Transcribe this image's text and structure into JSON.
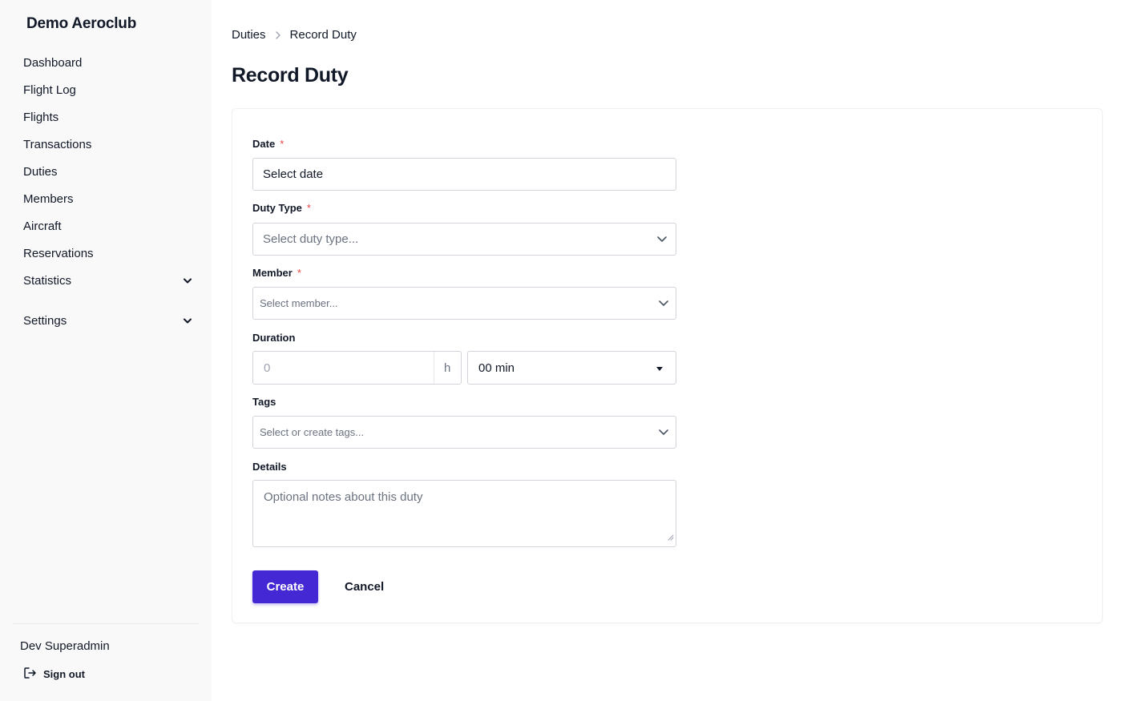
{
  "app": {
    "brand": "Demo Aeroclub"
  },
  "sidebar": {
    "items": [
      {
        "label": "Dashboard"
      },
      {
        "label": "Flight Log"
      },
      {
        "label": "Flights"
      },
      {
        "label": "Transactions"
      },
      {
        "label": "Duties"
      },
      {
        "label": "Members"
      },
      {
        "label": "Aircraft"
      },
      {
        "label": "Reservations"
      },
      {
        "label": "Statistics",
        "icon": "chevron-down-icon"
      },
      {
        "label": "Settings",
        "icon": "chevron-down-icon"
      }
    ],
    "user": {
      "name": "Dev Superadmin",
      "sign_out_label": "Sign out",
      "sign_out_icon": "sign-out-icon"
    }
  },
  "breadcrumb": {
    "parent": "Duties",
    "current": "Record Duty",
    "separator_icon": "chevron-right-icon"
  },
  "page": {
    "title": "Record Duty"
  },
  "form": {
    "required_marker": "*",
    "date": {
      "label": "Date",
      "required": true,
      "placeholder": "Select date"
    },
    "duty_type": {
      "label": "Duty Type",
      "required": true,
      "placeholder": "Select duty type..."
    },
    "member": {
      "label": "Member",
      "required": true,
      "placeholder": "Select member..."
    },
    "duration": {
      "label": "Duration",
      "hours_placeholder": "0",
      "hours_unit": "h",
      "minutes_value": "00 min"
    },
    "tags": {
      "label": "Tags",
      "placeholder": "Select or create tags..."
    },
    "details": {
      "label": "Details",
      "placeholder": "Optional notes about this duty"
    },
    "create_label": "Create",
    "cancel_label": "Cancel"
  },
  "colors": {
    "primary": "#4328d4",
    "required": "#ef4444",
    "sidebar_bg": "#f9f9f9"
  }
}
